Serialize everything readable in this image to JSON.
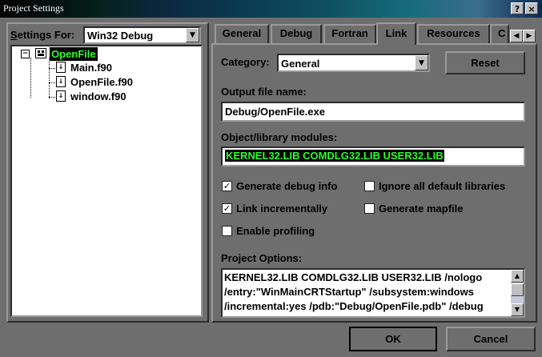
{
  "window": {
    "title": "Project Settings",
    "help_btn": "?",
    "close_btn": "×"
  },
  "left": {
    "settings_for_label": "Settings For:",
    "config_value": "Win32 Debug",
    "tree": {
      "project": "OpenFile",
      "expander": "−",
      "files": [
        "Main.f90",
        "OpenFile.f90",
        "window.f90"
      ]
    }
  },
  "tabs": [
    "General",
    "Debug",
    "Fortran",
    "Link",
    "Resources",
    "C"
  ],
  "active_tab": "Link",
  "tab_scroll": {
    "left": "◀",
    "right": "▶"
  },
  "link": {
    "category_label": "Category:",
    "category_value": "General",
    "reset_label": "Reset",
    "output_label": "Output file name:",
    "output_value": "Debug/OpenFile.exe",
    "objlib_label": "Object/library modules:",
    "objlib_value": "KERNEL32.LIB COMDLG32.LIB USER32.LIB",
    "checkboxes": [
      {
        "label": "Generate debug info",
        "checked": true
      },
      {
        "label": "Ignore all default libraries",
        "checked": false
      },
      {
        "label": "Link incrementally",
        "checked": true
      },
      {
        "label": "Generate mapfile",
        "checked": false
      },
      {
        "label": "Enable profiling",
        "checked": false
      }
    ],
    "check_mark": "✓",
    "options_label": "Project Options:",
    "options_lines": [
      "KERNEL32.LIB COMDLG32.LIB USER32.LIB /nologo",
      "/entry:\"WinMainCRTStartup\" /subsystem:windows",
      "/incremental:yes /pdb:\"Debug/OpenFile.pdb\" /debug"
    ]
  },
  "buttons": {
    "ok": "OK",
    "cancel": "Cancel"
  },
  "colors": {
    "selection_bg": "#000000",
    "selection_fg": "#29ff29",
    "dialog_bg": "#6e6e6e"
  }
}
